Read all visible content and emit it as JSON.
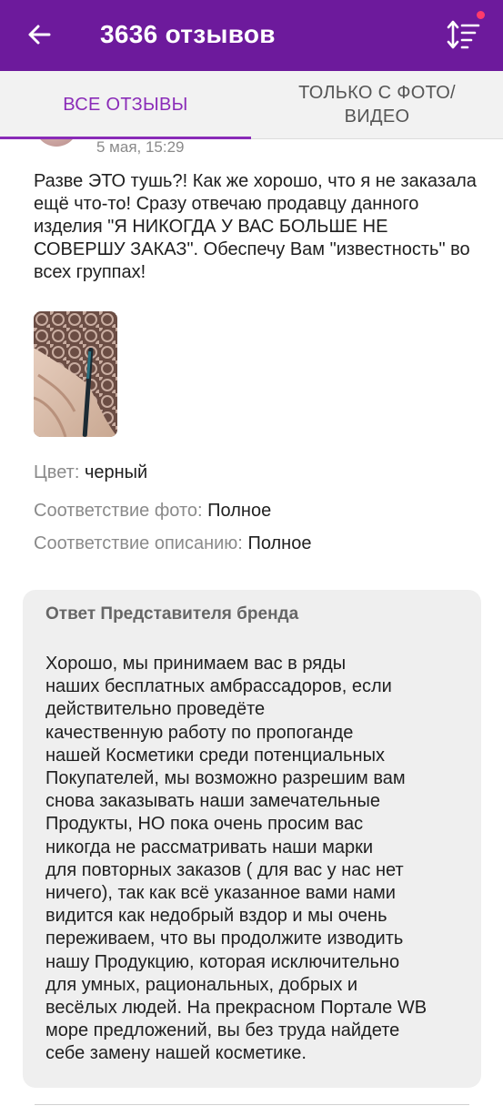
{
  "header": {
    "title": "3636 отзывов",
    "back_icon": "arrow-left-icon",
    "sort_icon": "sort-icon",
    "colors": {
      "bar": "#6d1a9c",
      "accent": "#8a2bb8",
      "dot": "#ff3b6b"
    }
  },
  "tabs": [
    {
      "label": "ВСЕ ОТЗЫВЫ",
      "active": true
    },
    {
      "label": "ТОЛЬКО С ФОТО/\nВИДЕО",
      "active": false
    }
  ],
  "review": {
    "date": "5 мая, 15:29",
    "text": "Разве ЭТО тушь?! Как же хорошо, что я не заказала ещё что-то! Сразу отвечаю продавцу данного изделия \"Я НИКОГДА У ВАС БОЛЬШЕ НЕ СОВЕРШУ ЗАКАЗ\". Обеспечу Вам \"известность\" во всех группах!",
    "color_label": "Цвет:",
    "color_value": "черный",
    "photo_match_label": "Соответствие фото:",
    "photo_match_value": "Полное",
    "desc_match_label": "Соответствие описанию:",
    "desc_match_value": "Полное"
  },
  "answer": {
    "title": "Ответ Представителя бренда",
    "text": "Хорошо, мы принимаем вас в ряды\nнаших бесплатных амбрассадоров, если\nдействительно проведёте\nкачественную  работу по пропоганде\nнашей Косметики среди потенциальных\nПокупателей, мы возможно разрешим вам\nснова заказывать наши замечательные\nПродукты, НО пока очень просим вас\nникогда не рассматривать наши марки\nдля повторных заказов ( для вас у нас нет\nничего), так как всё указанное вами нами\nвидится как недобрый вздор и мы очень\nпереживаем, что вы продолжите изводить\nнашу Продукцию, которая исключительно\nдля умных, рациональных, добрых и\nвесёлых людей. На прекрасном Портале WB\nморе предложений, вы без труда найдете\nсебе замену нашей косметике."
  }
}
